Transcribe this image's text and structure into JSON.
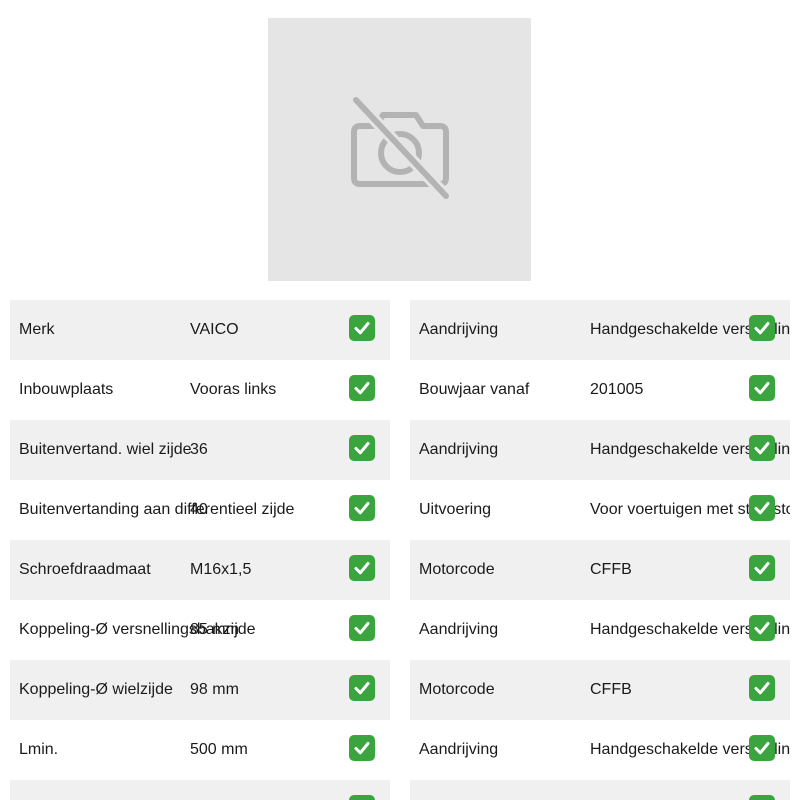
{
  "image": {
    "icon": "camera-off-icon"
  },
  "colors": {
    "shaded_row": "#f0f0f0",
    "check": "#3aa53f",
    "placeholder": "#e5e5e5"
  },
  "left_specs": [
    {
      "label": "Merk",
      "value": "VAICO"
    },
    {
      "label": "Inbouwplaats",
      "value": "Vooras links"
    },
    {
      "label": "Buitenvertand. wiel zijde",
      "value": "36"
    },
    {
      "label": "Buitenvertanding aan differentieel zijde",
      "value": "40"
    },
    {
      "label": "Schroefdraadmaat",
      "value": "M16x1,5"
    },
    {
      "label": "Koppeling-Ø versnellingsbakzijde",
      "value": "85 mm"
    },
    {
      "label": "Koppeling-Ø wielzijde",
      "value": "98 mm"
    },
    {
      "label": "Lmin.",
      "value": "500 mm"
    },
    {
      "label": "",
      "value": ""
    }
  ],
  "right_specs": [
    {
      "label": "Aandrijving",
      "value": "Handgeschakelde versnellingsbak"
    },
    {
      "label": "Bouwjaar vanaf",
      "value": "201005"
    },
    {
      "label": "Aandrijving",
      "value": "Handgeschakelde versnellingsbak"
    },
    {
      "label": "Uitvoering",
      "value": "Voor voertuigen met start/stop-systeem"
    },
    {
      "label": "Motorcode",
      "value": "CFFB"
    },
    {
      "label": "Aandrijving",
      "value": "Handgeschakelde versnellingsbak"
    },
    {
      "label": "Motorcode",
      "value": "CFFB"
    },
    {
      "label": "Aandrijving",
      "value": "Handgeschakelde versnellingsbak"
    },
    {
      "label": "",
      "value": ""
    }
  ]
}
